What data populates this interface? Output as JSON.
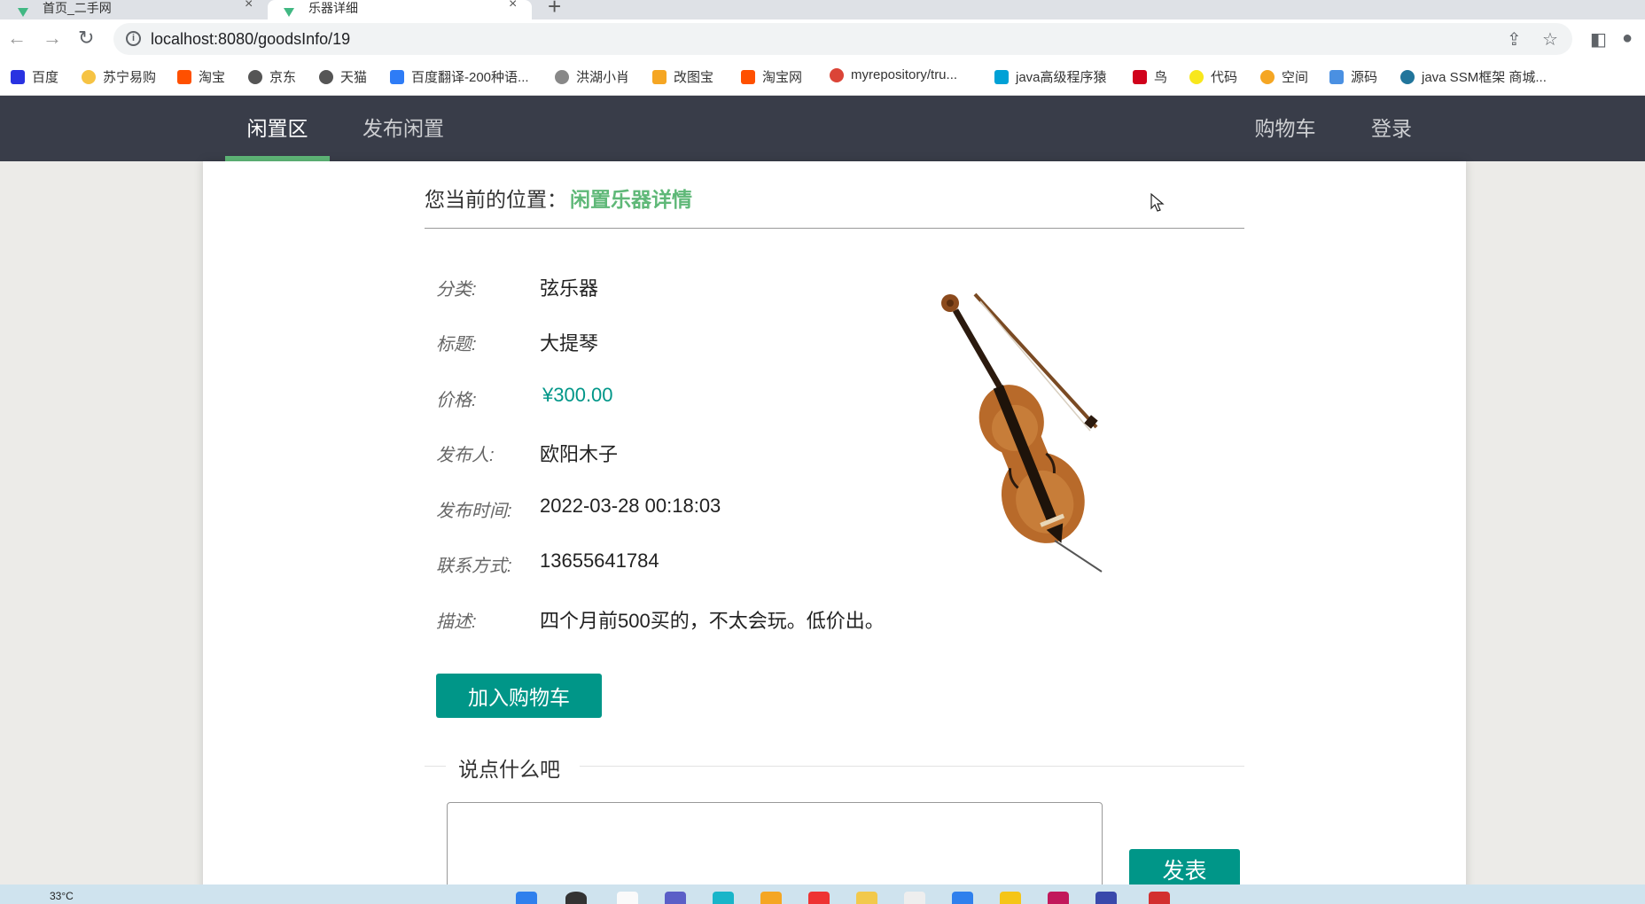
{
  "browser": {
    "tabs": [
      {
        "label": "首页_二手网"
      },
      {
        "label": "乐器详细"
      }
    ],
    "new_tab": "+",
    "url": "localhost:8080/goodsInfo/19",
    "bookmarks": [
      {
        "label": "百度",
        "color": "#2932e1"
      },
      {
        "label": "苏宁易购",
        "color": "#f6c343"
      },
      {
        "label": "淘宝",
        "color": "#ff5000"
      },
      {
        "label": "京东",
        "color": "#555555"
      },
      {
        "label": "天猫",
        "color": "#555555"
      },
      {
        "label": "百度翻译-200种语...",
        "color": "#2e7cf6"
      },
      {
        "label": "洪湖小肖",
        "color": "#888888"
      },
      {
        "label": "改图宝",
        "color": "#f5a623"
      },
      {
        "label": "淘宝网",
        "color": "#ff5000"
      },
      {
        "label": "myrepository/tru...",
        "color": "#db4437"
      },
      {
        "label": "java高级程序猿",
        "color": "#00a1d6"
      },
      {
        "label": "鸟",
        "color": "#d0021b"
      },
      {
        "label": "代码",
        "color": "#f8e71c"
      },
      {
        "label": "空间",
        "color": "#f5a623"
      },
      {
        "label": "源码",
        "color": "#4a90e2"
      },
      {
        "label": "java SSM框架 商城...",
        "color": "#21759b"
      }
    ]
  },
  "nav": {
    "items": [
      {
        "label": "闲置区",
        "active": true
      },
      {
        "label": "发布闲置",
        "active": false
      }
    ],
    "right_items": [
      {
        "label": "购物车"
      },
      {
        "label": "登录"
      }
    ]
  },
  "breadcrumb": {
    "label": "您当前的位置：",
    "current": "闲置乐器详情"
  },
  "product": {
    "fields": [
      {
        "label": "分类:",
        "value": "弦乐器"
      },
      {
        "label": "标题:",
        "value": "大提琴"
      },
      {
        "label": "价格:",
        "value": "¥300.00"
      },
      {
        "label": "发布人:",
        "value": "欧阳木子"
      },
      {
        "label": "发布时间:",
        "value": "2022-03-28 00:18:03"
      },
      {
        "label": "联系方式:",
        "value": "13655641784"
      },
      {
        "label": "描述:",
        "value": "四个月前500买的，不太会玩。低价出。"
      }
    ],
    "add_to_cart": "加入购物车"
  },
  "comments": {
    "title": "说点什么吧",
    "input_value": "",
    "post_button": "发表"
  },
  "taskbar": {
    "weather": "33°C"
  },
  "colors": {
    "nav_bg": "#393d49",
    "accent_green": "#5fb878",
    "button_teal": "#009688"
  }
}
